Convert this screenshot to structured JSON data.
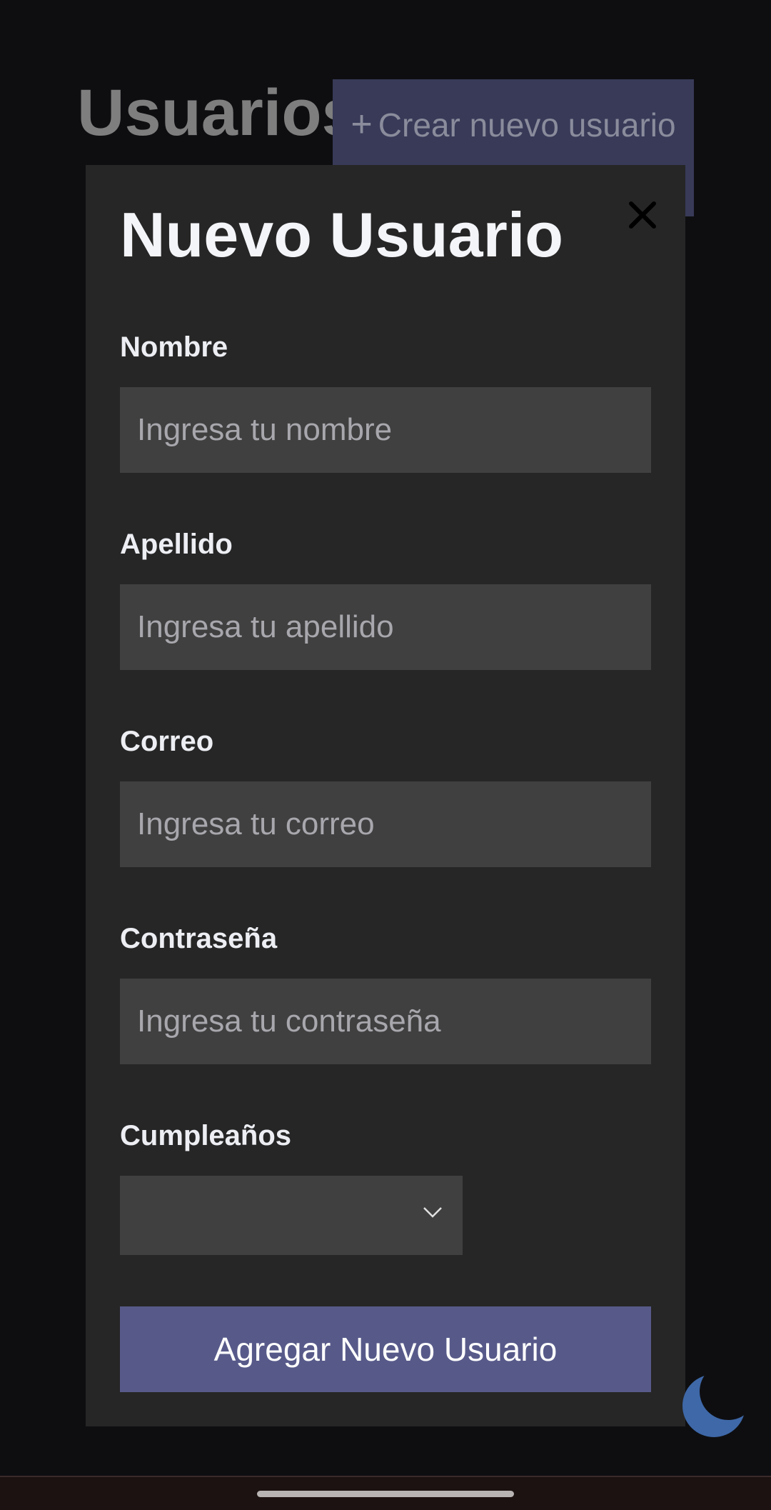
{
  "page": {
    "title": "Usuarios",
    "create_button": {
      "icon": "plus-icon",
      "label": "Crear nuevo usuario"
    }
  },
  "modal": {
    "title": "Nuevo Usuario",
    "close_icon": "close-icon",
    "fields": [
      {
        "label": "Nombre",
        "placeholder": "Ingresa tu nombre",
        "value": ""
      },
      {
        "label": "Apellido",
        "placeholder": "Ingresa tu apellido",
        "value": ""
      },
      {
        "label": "Correo",
        "placeholder": "Ingresa tu correo",
        "value": ""
      },
      {
        "label": "Contraseña",
        "placeholder": "Ingresa tu contraseña",
        "value": ""
      }
    ],
    "birthday": {
      "label": "Cumpleaños",
      "selected": ""
    },
    "submit_label": "Agregar Nuevo Usuario"
  },
  "theme_toggle_icon": "moon-icon",
  "colors": {
    "background": "#0e0e11",
    "modal": "#262626",
    "input": "#404040",
    "accent": "#575a89",
    "create_button": "#383a58",
    "moon": "#3e68a8"
  }
}
